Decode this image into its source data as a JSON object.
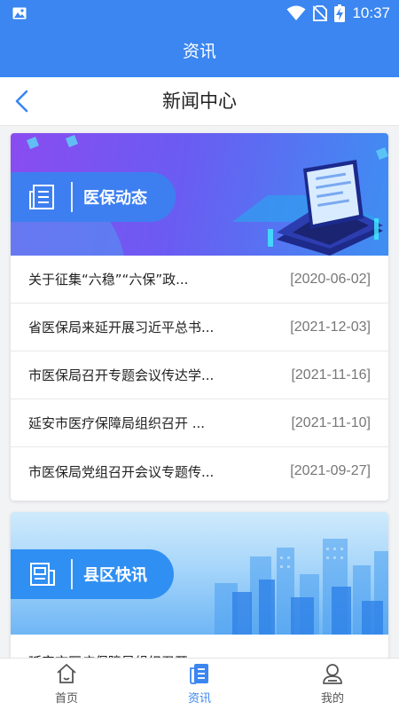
{
  "status_bar": {
    "time": "10:37"
  },
  "header": {
    "title": "资讯"
  },
  "subheader": {
    "title": "新闻中心"
  },
  "sections": [
    {
      "title": "医保动态",
      "items": [
        {
          "title": "关于征集“六稳”“六保”政...",
          "date": "[2020-06-02]"
        },
        {
          "title": "省医保局来延开展习近平总书...",
          "date": "[2021-12-03]"
        },
        {
          "title": "市医保局召开专题会议传达学...",
          "date": "[2021-11-16]"
        },
        {
          "title": "延安市医疗保障局组织召开 ...",
          "date": "[2021-11-10]"
        },
        {
          "title": "市医保局党组召开会议专题传...",
          "date": "[2021-09-27]"
        }
      ]
    },
    {
      "title": "县区快讯",
      "items": [
        {
          "title": "延安市医疗保障局组织召开",
          "date": ""
        }
      ]
    }
  ],
  "tabs": [
    {
      "label": "首页",
      "icon": "home-icon"
    },
    {
      "label": "资讯",
      "icon": "news-icon",
      "active": true
    },
    {
      "label": "我的",
      "icon": "user-icon"
    }
  ],
  "colors": {
    "primary": "#3b86f0",
    "background": "#f2f3f5"
  }
}
